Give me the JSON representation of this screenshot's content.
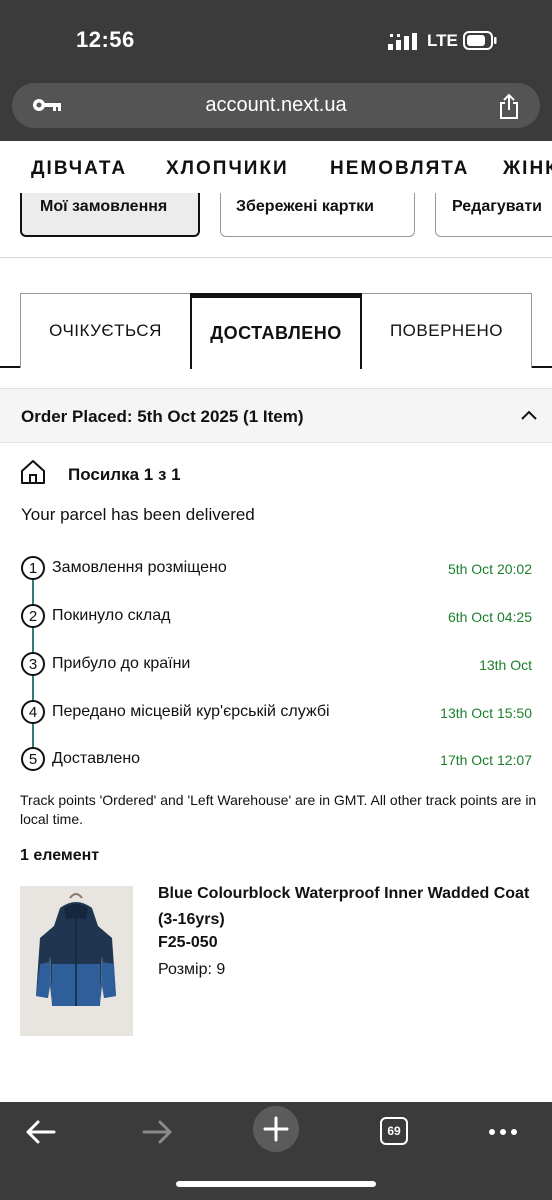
{
  "status_bar": {
    "time": "12:56",
    "network": "LTE"
  },
  "browser": {
    "url": "account.next.ua"
  },
  "category_nav": [
    "ДІВЧАТА",
    "ХЛОПЧИКИ",
    "НЕМОВЛЯТА",
    "ЖІНК"
  ],
  "account_buttons": [
    "Мої замовлення",
    "Збережені картки",
    "Редагувати"
  ],
  "tabs": [
    "ОЧІКУЄТЬСЯ",
    "ДОСТАВЛЕНО",
    "ПОВЕРНЕНО"
  ],
  "order": {
    "title": "Order Placed: 5th Oct 2025 (1 Item)",
    "parcel_title": "Посилка 1 з 1",
    "parcel_status": "Your parcel has been delivered",
    "timeline": [
      {
        "num": "1",
        "label": "Замовлення розміщено",
        "date": "5th Oct 20:02"
      },
      {
        "num": "2",
        "label": "Покинуло склад",
        "date": "6th Oct 04:25"
      },
      {
        "num": "3",
        "label": "Прибуло до країни",
        "date": "13th Oct"
      },
      {
        "num": "4",
        "label": "Передано місцевій кур'єрській службі",
        "date": "13th Oct 15:50"
      },
      {
        "num": "5",
        "label": "Доставлено",
        "date": "17th Oct 12:07"
      }
    ],
    "track_note": "Track points 'Ordered' and 'Left Warehouse' are in GMT. All other track points are in local time.",
    "items_count": "1 елемент",
    "product": {
      "name": "Blue Colourblock Waterproof Inner Wadded Coat (3-16yrs)",
      "code": "F25-050",
      "size": "Розмір: 9"
    }
  },
  "toolbar": {
    "tab_count": "69"
  },
  "colors": {
    "chrome": "#3b3b3b",
    "timeline_line": "#2e7d7a",
    "date_green": "#1e7f2d"
  }
}
